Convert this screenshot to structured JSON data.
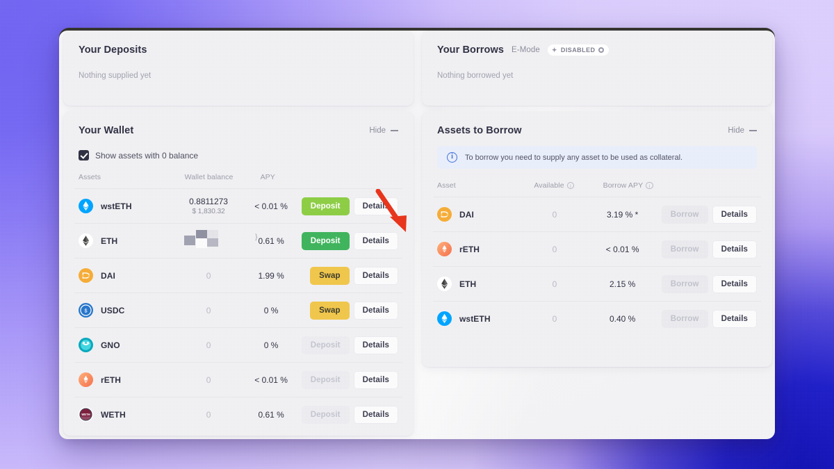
{
  "deposits_panel": {
    "title": "Your Deposits",
    "empty_text": "Nothing supplied yet"
  },
  "borrows_panel": {
    "title": "Your Borrows",
    "emode_label": "E-Mode",
    "emode_status": "DISABLED",
    "empty_text": "Nothing borrowed yet"
  },
  "wallet_panel": {
    "title": "Your Wallet",
    "hide_label": "Hide",
    "checkbox_label": "Show assets with 0 balance",
    "checkbox_checked": true,
    "columns": [
      "Assets",
      "Wallet balance",
      "APY",
      ""
    ],
    "rows": [
      {
        "icon": "wsteth-icon",
        "asset": "wstETH",
        "balance": "0.8811273",
        "balance_usd": "$ 1,830.32",
        "balance_redacted": false,
        "apy": "< 0.01 %",
        "action_label": "Deposit",
        "action_style": "green-hover",
        "action_disabled": false,
        "details_label": "Details"
      },
      {
        "icon": "eth-icon",
        "asset": "ETH",
        "balance": "",
        "balance_usd": "",
        "balance_redacted": true,
        "balance_fragment": "}",
        "apy": "0.61 %",
        "action_label": "Deposit",
        "action_style": "green",
        "action_disabled": false,
        "details_label": "Details"
      },
      {
        "icon": "dai-icon",
        "asset": "DAI",
        "balance": "0",
        "balance_usd": "",
        "balance_redacted": false,
        "apy": "1.99 %",
        "action_label": "Swap",
        "action_style": "yellow",
        "action_disabled": false,
        "details_label": "Details"
      },
      {
        "icon": "usdc-icon",
        "asset": "USDC",
        "balance": "0",
        "balance_usd": "",
        "balance_redacted": false,
        "apy": "0 %",
        "action_label": "Swap",
        "action_style": "yellow",
        "action_disabled": false,
        "details_label": "Details"
      },
      {
        "icon": "gno-icon",
        "asset": "GNO",
        "balance": "0",
        "balance_usd": "",
        "balance_redacted": false,
        "apy": "0 %",
        "action_label": "Deposit",
        "action_style": "disabled",
        "action_disabled": true,
        "details_label": "Details"
      },
      {
        "icon": "reth-icon",
        "asset": "rETH",
        "balance": "0",
        "balance_usd": "",
        "balance_redacted": false,
        "apy": "< 0.01 %",
        "action_label": "Deposit",
        "action_style": "disabled",
        "action_disabled": true,
        "details_label": "Details"
      },
      {
        "icon": "weth-icon",
        "asset": "WETH",
        "balance": "0",
        "balance_usd": "",
        "balance_redacted": false,
        "apy": "0.61 %",
        "action_label": "Deposit",
        "action_style": "disabled",
        "action_disabled": true,
        "details_label": "Details"
      }
    ]
  },
  "borrow_panel": {
    "title": "Assets to Borrow",
    "hide_label": "Hide",
    "info_text": "To borrow you need to supply any asset to be used as collateral.",
    "columns": [
      "Asset",
      "Available",
      "Borrow APY",
      ""
    ],
    "rows": [
      {
        "icon": "dai-icon",
        "asset": "DAI",
        "available": "0",
        "apy": "3.19 % *",
        "action_label": "Borrow",
        "details_label": "Details"
      },
      {
        "icon": "reth-icon",
        "asset": "rETH",
        "available": "0",
        "apy": "< 0.01 %",
        "action_label": "Borrow",
        "details_label": "Details"
      },
      {
        "icon": "eth-icon",
        "asset": "ETH",
        "available": "0",
        "apy": "2.15 %",
        "action_label": "Borrow",
        "details_label": "Details"
      },
      {
        "icon": "wsteth-icon",
        "asset": "wstETH",
        "available": "0",
        "apy": "0.40 %",
        "action_label": "Borrow",
        "details_label": "Details"
      }
    ]
  },
  "annotation": {
    "arrow_color": "#e8341c",
    "points_to": "deposit-button-wsteth"
  },
  "colors": {
    "accent_green": "#3fb35c",
    "accent_green_hover": "#8ccd45",
    "accent_yellow": "#f0c64b",
    "info_blue": "#3f6fd8",
    "text_dark": "#2f3043"
  }
}
